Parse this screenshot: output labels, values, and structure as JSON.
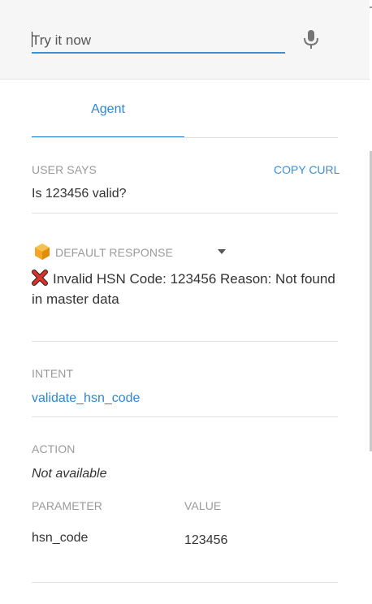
{
  "input": {
    "placeholder": "Try it now"
  },
  "tabs": {
    "agent_label": "Agent"
  },
  "user_says": {
    "label": "USER SAYS",
    "copy_curl": "COPY CURL",
    "text": "Is 123456 valid?"
  },
  "default_response": {
    "label": "DEFAULT RESPONSE",
    "text": "Invalid HSN Code: 123456 Reason: Not found in master data"
  },
  "intent": {
    "label": "INTENT",
    "value": "validate_hsn_code"
  },
  "action": {
    "label": "ACTION",
    "value": "Not available"
  },
  "parameters": {
    "param_header": "PARAMETER",
    "value_header": "VALUE",
    "rows": [
      {
        "name": "hsn_code",
        "value": "123456"
      }
    ]
  },
  "icons": {
    "mic": "microphone-icon",
    "response": "hexagon-icon",
    "error": "red-x-icon",
    "dropdown": "caret-down-icon"
  },
  "colors": {
    "accent": "#2b87d3",
    "response_icon": "#f5a623",
    "error": "#d9342b"
  }
}
